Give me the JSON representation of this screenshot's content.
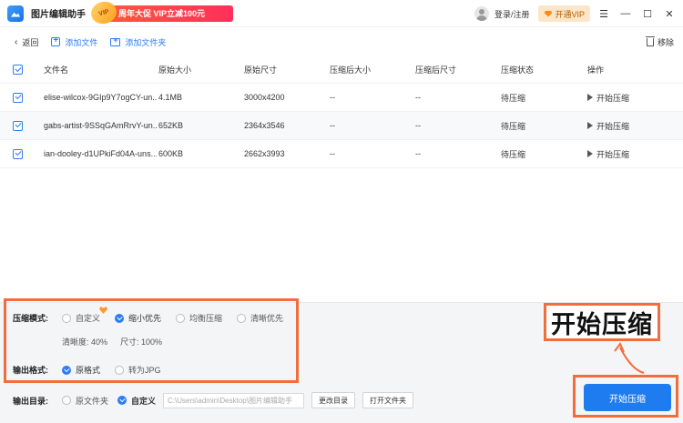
{
  "titlebar": {
    "app_title": "图片编辑助手",
    "promo_badge": "VIP",
    "promo_text": "周年大促 VIP立减100元",
    "login": "登录/注册",
    "vip_button": "开通VIP",
    "win_menu": "☰",
    "win_min": "—",
    "win_max": "☐",
    "win_close": "✕"
  },
  "toolbar": {
    "back": "返回",
    "add_file": "添加文件",
    "add_folder": "添加文件夹",
    "remove": "移除"
  },
  "table": {
    "headers": {
      "name": "文件名",
      "orig_size": "原始大小",
      "orig_dim": "原始尺寸",
      "comp_size": "压缩后大小",
      "comp_dim": "压缩后尺寸",
      "status": "压缩状态",
      "op": "操作"
    },
    "rows": [
      {
        "name": "elise-wilcox-9GIp9Y7ogCY-un...",
        "size": "4.1MB",
        "dim": "3000x4200",
        "csize": "--",
        "cdim": "--",
        "status": "待压缩",
        "op": "开始压缩"
      },
      {
        "name": "gabs-artist-9SSqGAmRrvY-un...",
        "size": "652KB",
        "dim": "2364x3546",
        "csize": "--",
        "cdim": "--",
        "status": "待压缩",
        "op": "开始压缩"
      },
      {
        "name": "ian-dooley-d1UPkiFd04A-uns...",
        "size": "600KB",
        "dim": "2662x3993",
        "csize": "--",
        "cdim": "--",
        "status": "待压缩",
        "op": "开始压缩"
      }
    ]
  },
  "settings": {
    "mode_label": "压缩模式:",
    "modes": [
      "自定义",
      "缩小优先",
      "均衡压缩",
      "清晰优先"
    ],
    "selected_mode": "缩小优先",
    "clarity": "清晰度:  40%",
    "dimension": "尺寸:  100%",
    "format_label": "输出格式:",
    "formats": [
      "原格式",
      "转为JPG"
    ],
    "selected_format": "原格式",
    "output_label": "输出目录:",
    "outputs": [
      "原文件夹",
      "自定义"
    ],
    "selected_output": "自定义",
    "path_value": "C:\\Users\\admin\\Desktop\\图片编辑助手",
    "change_dir": "更改目录",
    "open_folder": "打开文件夹"
  },
  "callout_text": "开始压缩",
  "start_button": "开始压缩",
  "colors": {
    "accent": "#1f7bf0",
    "highlight": "#f26d3d"
  }
}
